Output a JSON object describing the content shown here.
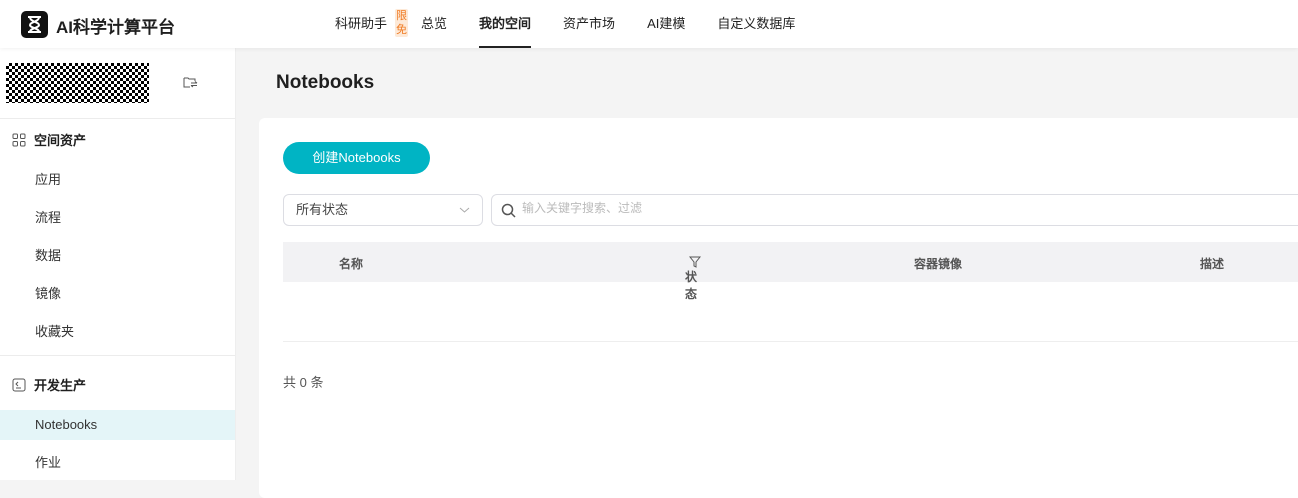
{
  "header": {
    "brand": "AI科学计算平台",
    "nav": [
      {
        "label": "科研助手",
        "badge": "限免"
      },
      {
        "label": "总览"
      },
      {
        "label": "我的空间",
        "active": true
      },
      {
        "label": "资产市场"
      },
      {
        "label": "AI建模"
      },
      {
        "label": "自定义数据库"
      }
    ]
  },
  "sidebar": {
    "sections": [
      {
        "title": "空间资产",
        "icon": "grid-icon",
        "items": [
          "应用",
          "流程",
          "数据",
          "镜像",
          "收藏夹"
        ]
      },
      {
        "title": "开发生产",
        "icon": "terminal-icon",
        "items": [
          "Notebooks",
          "作业"
        ],
        "active": "Notebooks"
      }
    ]
  },
  "main": {
    "title": "Notebooks",
    "create_button": "创建Notebooks",
    "status_select": "所有状态",
    "search_placeholder": "输入关键字搜索、过滤",
    "columns": [
      "名称",
      "状态",
      "容器镜像",
      "描述"
    ],
    "total": "共 0 条"
  },
  "colors": {
    "accent": "#00b4c4",
    "badge": "#f07a22"
  }
}
